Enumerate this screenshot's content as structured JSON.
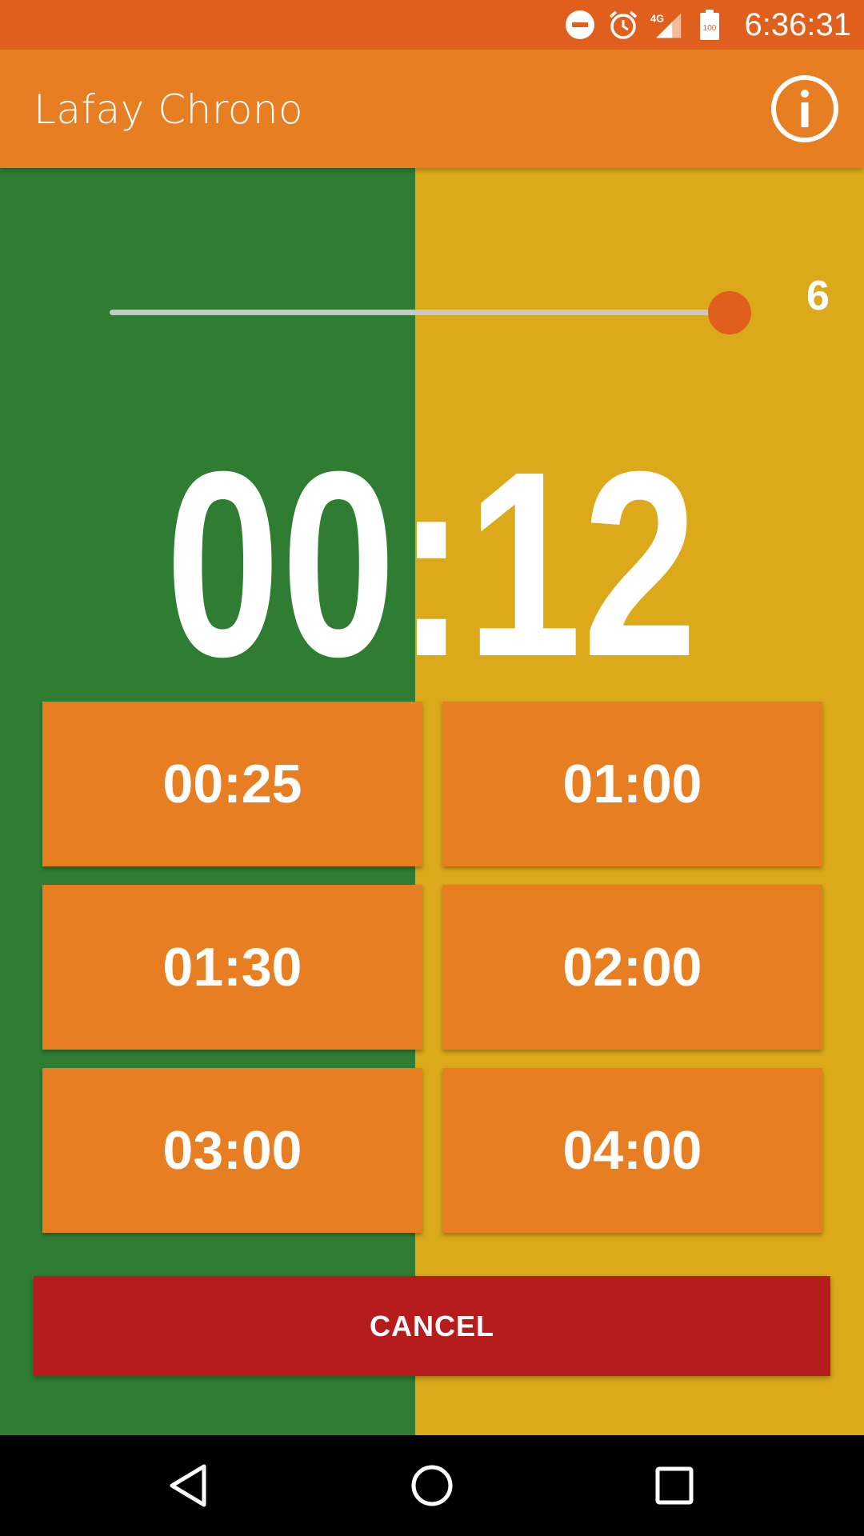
{
  "status_bar": {
    "time": "6:36:31",
    "battery_level": "100",
    "network": "4G",
    "icons": [
      "do-not-disturb-icon",
      "alarm-icon",
      "signal-4g-icon",
      "battery-icon"
    ]
  },
  "app_bar": {
    "title": "Lafay Chrono",
    "info_icon": "info-icon"
  },
  "colors": {
    "status_bar": "#e05f1d",
    "app_bar": "#e77e22",
    "left_bg": "#2e7d32",
    "right_bg": "#dba91a",
    "preset_button": "#e77e22",
    "cancel_button": "#b71c1c",
    "slider_thumb": "#e05f1d"
  },
  "slider": {
    "value": "6",
    "fraction": 1.0
  },
  "timer": {
    "display": "00:12"
  },
  "presets": [
    "00:25",
    "01:00",
    "01:30",
    "02:00",
    "03:00",
    "04:00"
  ],
  "cancel_label": "CANCEL",
  "nav_bar": {
    "icons": [
      "back-icon",
      "home-icon",
      "recents-icon"
    ]
  }
}
